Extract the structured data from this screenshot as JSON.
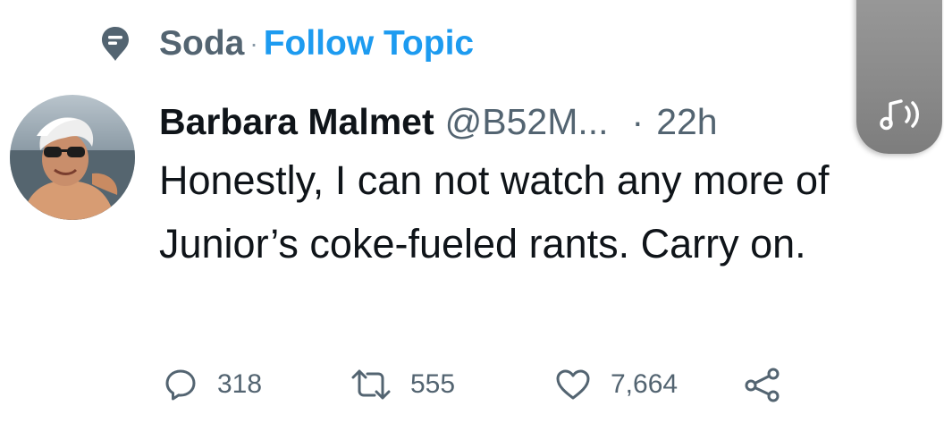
{
  "topic": {
    "icon": "topic-pin-icon",
    "name": "Soda",
    "separator": "·",
    "follow_label": "Follow Topic"
  },
  "tweet": {
    "avatar": "profile-avatar",
    "display_name": "Barbara Malmet",
    "handle": "@B52M...",
    "separator": "·",
    "time": "22h",
    "text": "Honestly, I can not watch any more of Junior’s coke-fueled rants. Carry on."
  },
  "actions": {
    "reply": {
      "icon": "reply-icon",
      "count": "318"
    },
    "retweet": {
      "icon": "retweet-icon",
      "count": "555"
    },
    "like": {
      "icon": "heart-icon",
      "count": "7,664"
    },
    "share": {
      "icon": "share-icon"
    }
  },
  "overlay": {
    "icon": "audio-note-icon"
  },
  "colors": {
    "primary_text": "#0f1419",
    "secondary_text": "#536471",
    "accent": "#1d9bf0"
  }
}
